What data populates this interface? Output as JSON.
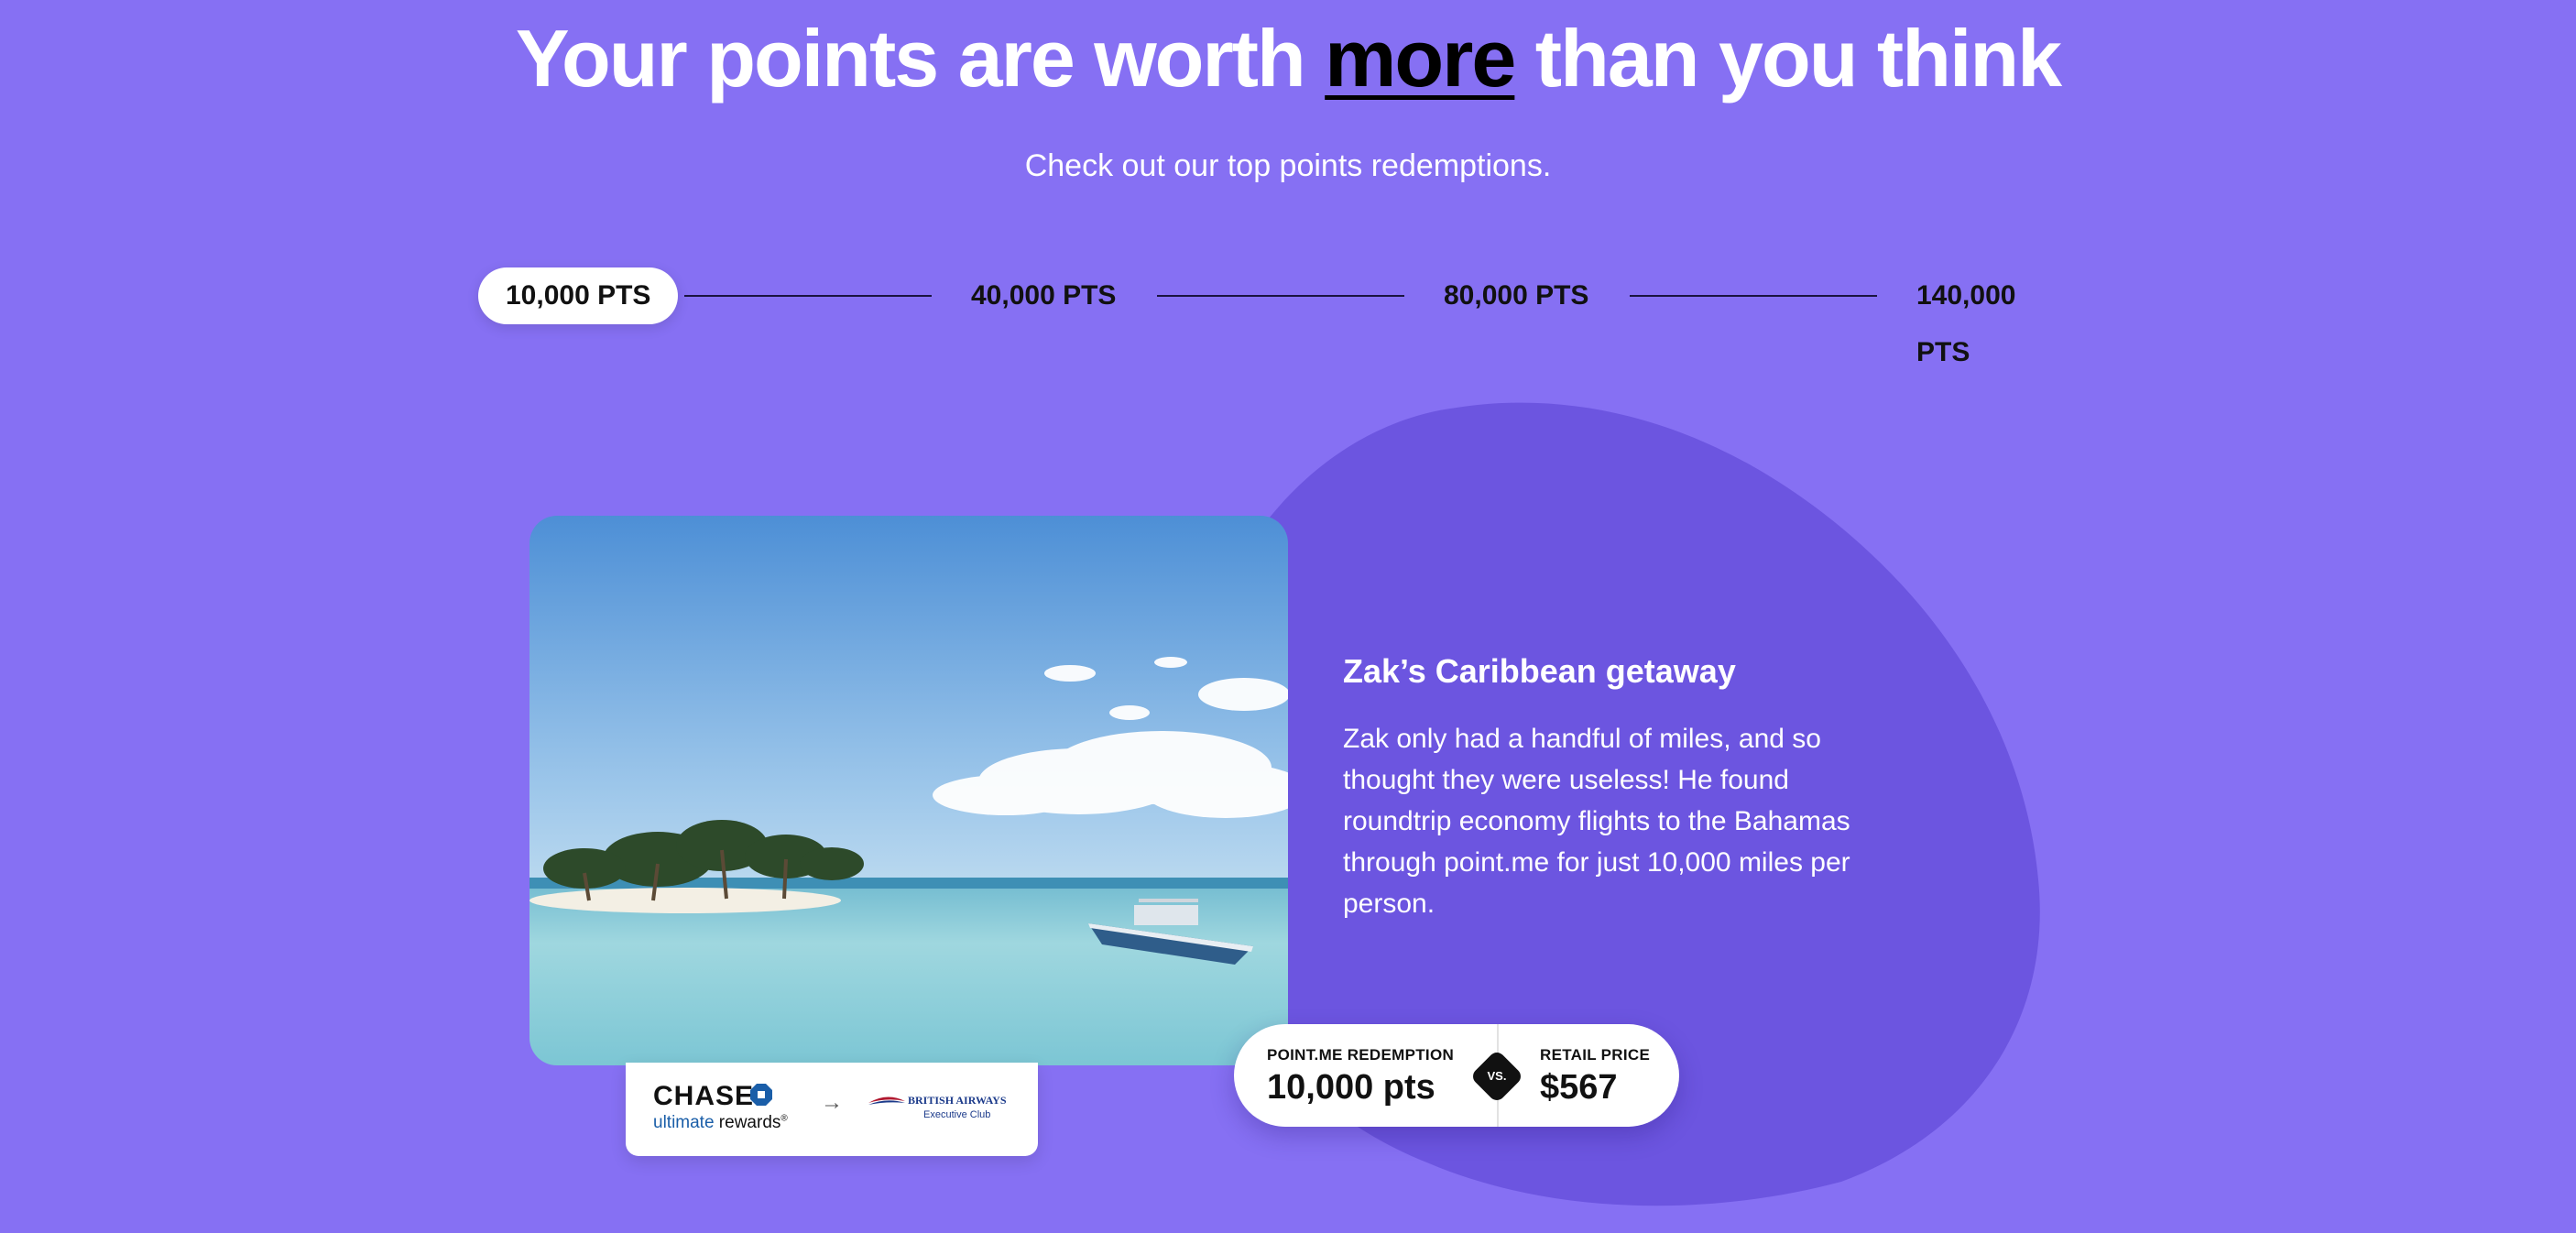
{
  "headline": {
    "before": "Your points are worth ",
    "emphasis": "more",
    "after": " than you think"
  },
  "subtitle": "Check out our top points redemptions.",
  "timeline": {
    "steps": [
      {
        "label": "10,000 PTS",
        "active": true
      },
      {
        "label": "40,000 PTS",
        "active": false
      },
      {
        "label": "80,000 PTS",
        "active": false
      },
      {
        "label": "140,000 PTS",
        "active": false
      }
    ]
  },
  "story": {
    "title": "Zak’s Caribbean getaway",
    "body": "Zak only had a handful of miles, and so thought they were useless! He found roundtrip economy flights to the Bahamas through point.me for just 10,000 miles per person."
  },
  "transfer": {
    "from_word": "CHASE",
    "from_line_blue": "ultimate",
    "from_line_rest": " rewards",
    "from_mark": "®",
    "arrow": "→",
    "to_name": "BRITISH AIRWAYS",
    "to_program": "Executive Club"
  },
  "comparison": {
    "left_label": "POINT.ME REDEMPTION",
    "left_value": "10,000 pts",
    "vs": "VS.",
    "right_label": "RETAIL PRICE",
    "right_value": "$567"
  },
  "colors": {
    "background": "#8670f3",
    "blob": "#6c55e0",
    "text": "#ffffff",
    "pill_bg": "#ffffff"
  },
  "icons": [
    "chase-octagon-logo",
    "arrow-right-icon",
    "british-airways-speedmarque-logo"
  ]
}
